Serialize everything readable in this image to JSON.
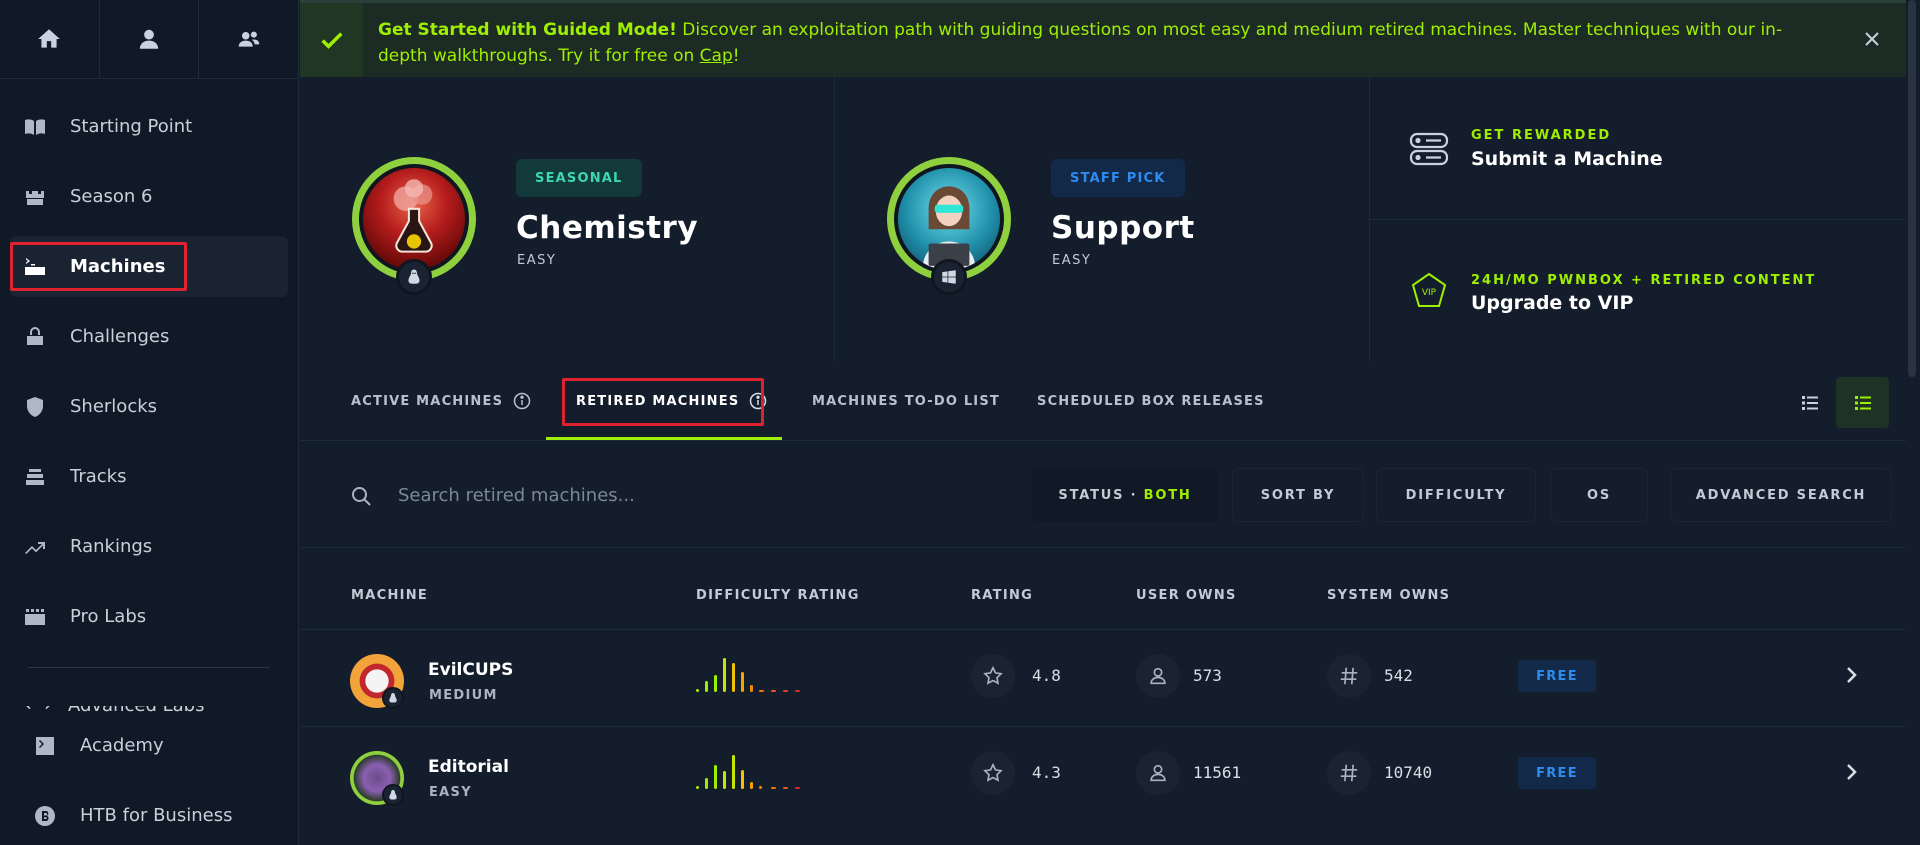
{
  "sidebar": {
    "top_icons": [
      "home-icon",
      "user-icon",
      "team-icon"
    ],
    "items": [
      {
        "label": "Starting Point",
        "icon": "book-icon"
      },
      {
        "label": "Season 6",
        "icon": "castle-icon"
      },
      {
        "label": "Machines",
        "icon": "server-terminal-icon"
      },
      {
        "label": "Challenges",
        "icon": "challenge-icon"
      },
      {
        "label": "Sherlocks",
        "icon": "shield-bolt-icon"
      },
      {
        "label": "Tracks",
        "icon": "stack-icon"
      },
      {
        "label": "Rankings",
        "icon": "trending-up-icon"
      },
      {
        "label": "Pro Labs",
        "icon": "labs-icon"
      }
    ],
    "active_item": "Machines",
    "cut_item_label": "Advanced Labs",
    "bottom_items": [
      {
        "label": "Academy",
        "icon": "academy-icon"
      },
      {
        "label": "HTB for Business",
        "icon": "business-icon"
      }
    ]
  },
  "banner": {
    "bold": "Get Started with Guided Mode!",
    "text": " Discover an exploitation path with guiding questions on most easy and medium retired machines. Master techniques with our in-depth walkthroughs. Try it for free on ",
    "link": "Cap",
    "end": "!"
  },
  "featured": [
    {
      "badge": "SEASONAL",
      "name": "Chemistry",
      "difficulty": "EASY"
    },
    {
      "badge": "STAFF PICK",
      "name": "Support",
      "difficulty": "EASY"
    }
  ],
  "promos": [
    {
      "kicker": "GET REWARDED",
      "title": "Submit a Machine"
    },
    {
      "kicker": "24H/MO PWNBOX + RETIRED CONTENT",
      "title": "Upgrade to VIP"
    }
  ],
  "tabs": [
    {
      "label": "ACTIVE MACHINES"
    },
    {
      "label": "RETIRED MACHINES"
    },
    {
      "label": "MACHINES TO-DO LIST"
    },
    {
      "label": "SCHEDULED BOX RELEASES"
    }
  ],
  "search": {
    "placeholder": "Search retired machines..."
  },
  "filters": {
    "status_label": "STATUS · ",
    "status_value": "BOTH",
    "sort_by": "SORT BY",
    "difficulty": "DIFFICULTY",
    "os": "OS",
    "advanced": "ADVANCED SEARCH"
  },
  "table": {
    "headers": [
      "MACHINE",
      "DIFFICULTY RATING",
      "RATING",
      "USER OWNS",
      "SYSTEM OWNS"
    ],
    "rows": [
      {
        "name": "EvilCUPS",
        "difficulty": "MEDIUM",
        "rating": "4.8",
        "user_owns": "573",
        "system_owns": "542",
        "tag": "FREE"
      },
      {
        "name": "Editorial",
        "difficulty": "EASY",
        "rating": "4.3",
        "user_owns": "11561",
        "system_owns": "10740",
        "tag": "FREE"
      }
    ]
  },
  "colors": {
    "accent": "#9fef00",
    "free": "#2d8cf0",
    "seasonal": "#3dd6b4"
  }
}
